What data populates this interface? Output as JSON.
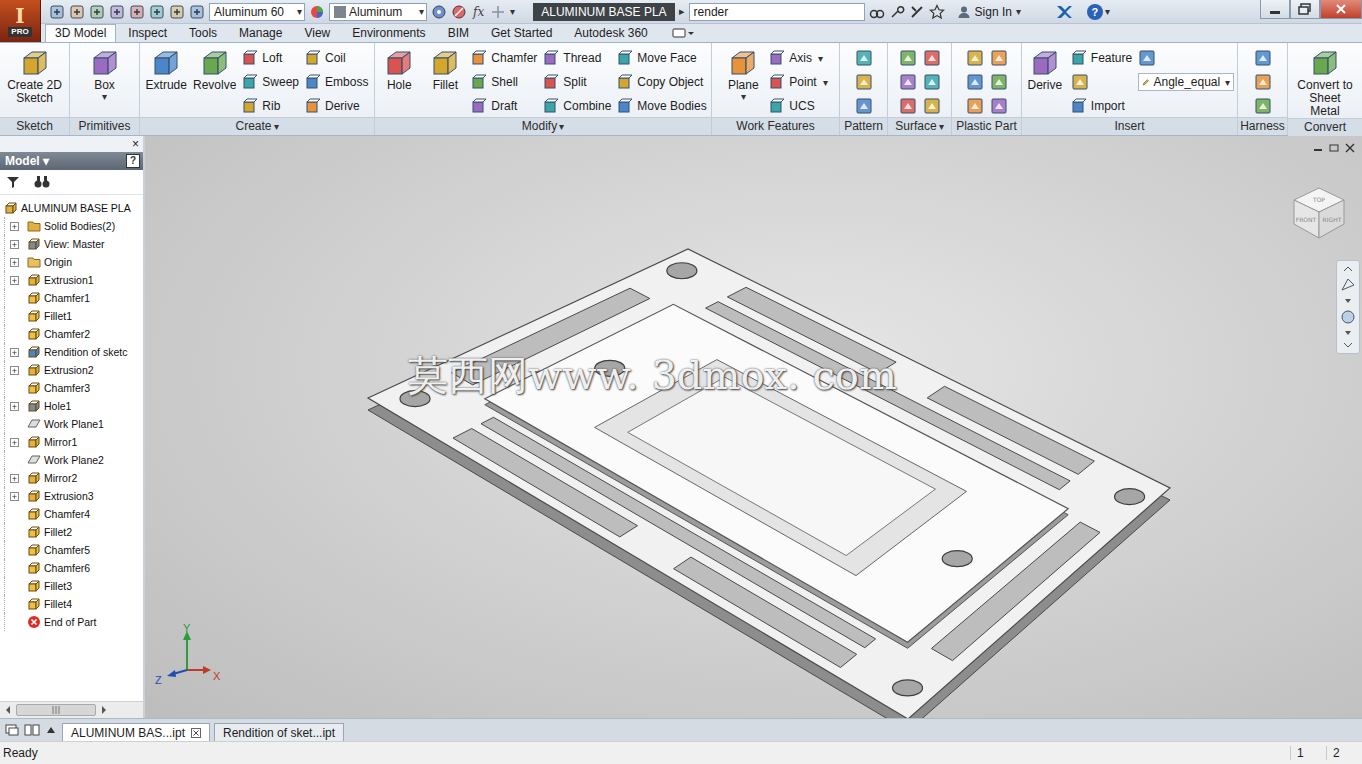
{
  "app_logo": {
    "letter": "I",
    "edition": "PRO"
  },
  "quick_access": {
    "material": "Aluminum 60",
    "appearance": "Aluminum",
    "formula": "fx",
    "document": "ALUMINUM BASE PLA",
    "arrow": "▸",
    "search": "render",
    "sign_in": "Sign In",
    "help": "?",
    "caret": "▾"
  },
  "tabs": [
    {
      "label": "3D Model",
      "selected": true
    },
    {
      "label": "Inspect",
      "selected": false
    },
    {
      "label": "Tools",
      "selected": false
    },
    {
      "label": "Manage",
      "selected": false
    },
    {
      "label": "View",
      "selected": false
    },
    {
      "label": "Environments",
      "selected": false
    },
    {
      "label": "BIM",
      "selected": false
    },
    {
      "label": "Get Started",
      "selected": false
    },
    {
      "label": "Autodesk 360",
      "selected": false
    }
  ],
  "ribbon": {
    "caret": "▾",
    "panels": [
      {
        "label": "Sketch",
        "menu": false,
        "groups": [
          [
            {
              "kind": "large",
              "label": "Create 2D Sketch",
              "dropdown": false
            }
          ]
        ]
      },
      {
        "label": "Primitives",
        "menu": false,
        "groups": [
          [
            {
              "kind": "large",
              "label": "Box",
              "dropdown": true
            }
          ]
        ]
      },
      {
        "label": "Create",
        "menu": true,
        "groups": [
          [
            {
              "kind": "large",
              "label": "Extrude",
              "dropdown": false
            }
          ],
          [
            {
              "kind": "large",
              "label": "Revolve",
              "dropdown": false
            }
          ],
          [
            {
              "kind": "small",
              "label": "Loft",
              "dropdown": false
            },
            {
              "kind": "small",
              "label": "Sweep",
              "dropdown": false
            },
            {
              "kind": "small",
              "label": "Rib",
              "dropdown": false
            }
          ],
          [
            {
              "kind": "small",
              "label": "Coil",
              "dropdown": false
            },
            {
              "kind": "small",
              "label": "Emboss",
              "dropdown": false
            },
            {
              "kind": "small",
              "label": "Derive",
              "dropdown": false
            }
          ]
        ]
      },
      {
        "label": "Modify",
        "menu": true,
        "groups": [
          [
            {
              "kind": "large",
              "label": "Hole",
              "dropdown": false
            }
          ],
          [
            {
              "kind": "large",
              "label": "Fillet",
              "dropdown": false
            }
          ],
          [
            {
              "kind": "small",
              "label": "Chamfer",
              "dropdown": false
            },
            {
              "kind": "small",
              "label": "Shell",
              "dropdown": false
            },
            {
              "kind": "small",
              "label": "Draft",
              "dropdown": false
            }
          ],
          [
            {
              "kind": "small",
              "label": "Thread",
              "dropdown": false
            },
            {
              "kind": "small",
              "label": "Split",
              "dropdown": false
            },
            {
              "kind": "small",
              "label": "Combine",
              "dropdown": false
            }
          ],
          [
            {
              "kind": "small",
              "label": "Move Face",
              "dropdown": false
            },
            {
              "kind": "small",
              "label": "Copy Object",
              "dropdown": false
            },
            {
              "kind": "small",
              "label": "Move Bodies",
              "dropdown": false
            }
          ]
        ]
      },
      {
        "label": "Work Features",
        "menu": false,
        "groups": [
          [
            {
              "kind": "large",
              "label": "Plane",
              "dropdown": true
            }
          ],
          [
            {
              "kind": "small",
              "label": "Axis",
              "dropdown": true
            },
            {
              "kind": "small",
              "label": "Point",
              "dropdown": true
            },
            {
              "kind": "small",
              "label": "UCS",
              "dropdown": false
            }
          ]
        ]
      },
      {
        "label": "Pattern",
        "menu": false,
        "groups": [
          [
            {
              "kind": "icon"
            },
            {
              "kind": "icon"
            },
            {
              "kind": "icon"
            }
          ]
        ]
      },
      {
        "label": "Surface",
        "menu": true,
        "groups": [
          [
            {
              "kind": "icon"
            },
            {
              "kind": "icon"
            },
            {
              "kind": "icon"
            }
          ],
          [
            {
              "kind": "icon"
            },
            {
              "kind": "icon"
            },
            {
              "kind": "icon"
            }
          ]
        ]
      },
      {
        "label": "Plastic Part",
        "menu": false,
        "groups": [
          [
            {
              "kind": "icon"
            },
            {
              "kind": "icon"
            },
            {
              "kind": "icon"
            }
          ],
          [
            {
              "kind": "icon"
            },
            {
              "kind": "icon"
            },
            {
              "kind": "icon"
            }
          ]
        ]
      },
      {
        "label": "Insert",
        "menu": false,
        "groups": [
          [
            {
              "kind": "large",
              "label": "Derive",
              "dropdown": false
            }
          ],
          [
            {
              "kind": "small",
              "label": "Feature",
              "dropdown": false
            },
            {
              "kind": "icon"
            },
            {
              "kind": "small",
              "label": "Import",
              "dropdown": false
            }
          ],
          [
            {
              "kind": "icon"
            },
            {
              "kind": "combo",
              "label": "Angle_equal",
              "dropdown": true
            }
          ]
        ]
      },
      {
        "label": "Harness",
        "menu": false,
        "groups": [
          [
            {
              "kind": "icon"
            },
            {
              "kind": "icon"
            },
            {
              "kind": "icon"
            }
          ]
        ]
      },
      {
        "label": "Convert",
        "menu": false,
        "groups": [
          [
            {
              "kind": "large",
              "label": "Convert to Sheet Metal",
              "dropdown": false
            }
          ]
        ]
      }
    ]
  },
  "browser": {
    "close": "×",
    "title": "Model",
    "caret": "▾",
    "help": "?",
    "expander": "+",
    "items": [
      {
        "label": "ALUMINUM BASE PLA",
        "kind": "part",
        "depth": 0,
        "expandable": false
      },
      {
        "label": "Solid Bodies(2)",
        "kind": "bodies",
        "depth": 1,
        "expandable": true
      },
      {
        "label": "View: Master",
        "kind": "view",
        "depth": 1,
        "expandable": true
      },
      {
        "label": "Origin",
        "kind": "folder",
        "depth": 1,
        "expandable": true
      },
      {
        "label": "Extrusion1",
        "kind": "extrude",
        "depth": 1,
        "expandable": true
      },
      {
        "label": "Chamfer1",
        "kind": "chamfer",
        "depth": 1,
        "expandable": false
      },
      {
        "label": "Fillet1",
        "kind": "fillet",
        "depth": 1,
        "expandable": false
      },
      {
        "label": "Chamfer2",
        "kind": "chamfer",
        "depth": 1,
        "expandable": false
      },
      {
        "label": "Rendition of sketc",
        "kind": "derived",
        "depth": 1,
        "expandable": true
      },
      {
        "label": "Extrusion2",
        "kind": "extrude",
        "depth": 1,
        "expandable": true
      },
      {
        "label": "Chamfer3",
        "kind": "chamfer",
        "depth": 1,
        "expandable": false
      },
      {
        "label": "Hole1",
        "kind": "hole",
        "depth": 1,
        "expandable": true
      },
      {
        "label": "Work Plane1",
        "kind": "plane",
        "depth": 1,
        "expandable": false
      },
      {
        "label": "Mirror1",
        "kind": "mirror",
        "depth": 1,
        "expandable": true
      },
      {
        "label": "Work Plane2",
        "kind": "plane",
        "depth": 1,
        "expandable": false
      },
      {
        "label": "Mirror2",
        "kind": "mirror",
        "depth": 1,
        "expandable": true
      },
      {
        "label": "Extrusion3",
        "kind": "extrude",
        "depth": 1,
        "expandable": true
      },
      {
        "label": "Chamfer4",
        "kind": "chamfer",
        "depth": 1,
        "expandable": false
      },
      {
        "label": "Fillet2",
        "kind": "fillet",
        "depth": 1,
        "expandable": false
      },
      {
        "label": "Chamfer5",
        "kind": "chamfer",
        "depth": 1,
        "expandable": false
      },
      {
        "label": "Chamfer6",
        "kind": "chamfer",
        "depth": 1,
        "expandable": false
      },
      {
        "label": "Fillet3",
        "kind": "fillet",
        "depth": 1,
        "expandable": false
      },
      {
        "label": "Fillet4",
        "kind": "fillet",
        "depth": 1,
        "expandable": false
      },
      {
        "label": "End of Part",
        "kind": "end",
        "depth": 1,
        "expandable": false
      }
    ]
  },
  "viewport": {
    "watermark": "莫西网www. 3dmox. com",
    "viewcube": {
      "top": "TOP",
      "front": "FRONT",
      "right": "RIGHT"
    },
    "axes": {
      "x": "X",
      "y": "Y",
      "z": "Z"
    }
  },
  "document_tabs": [
    {
      "label": "ALUMINUM BAS...ipt",
      "selected": true
    },
    {
      "label": "Rendition of sket...ipt",
      "selected": false
    }
  ],
  "status_bar": {
    "message": "Ready",
    "fields": [
      "1",
      "2"
    ]
  }
}
